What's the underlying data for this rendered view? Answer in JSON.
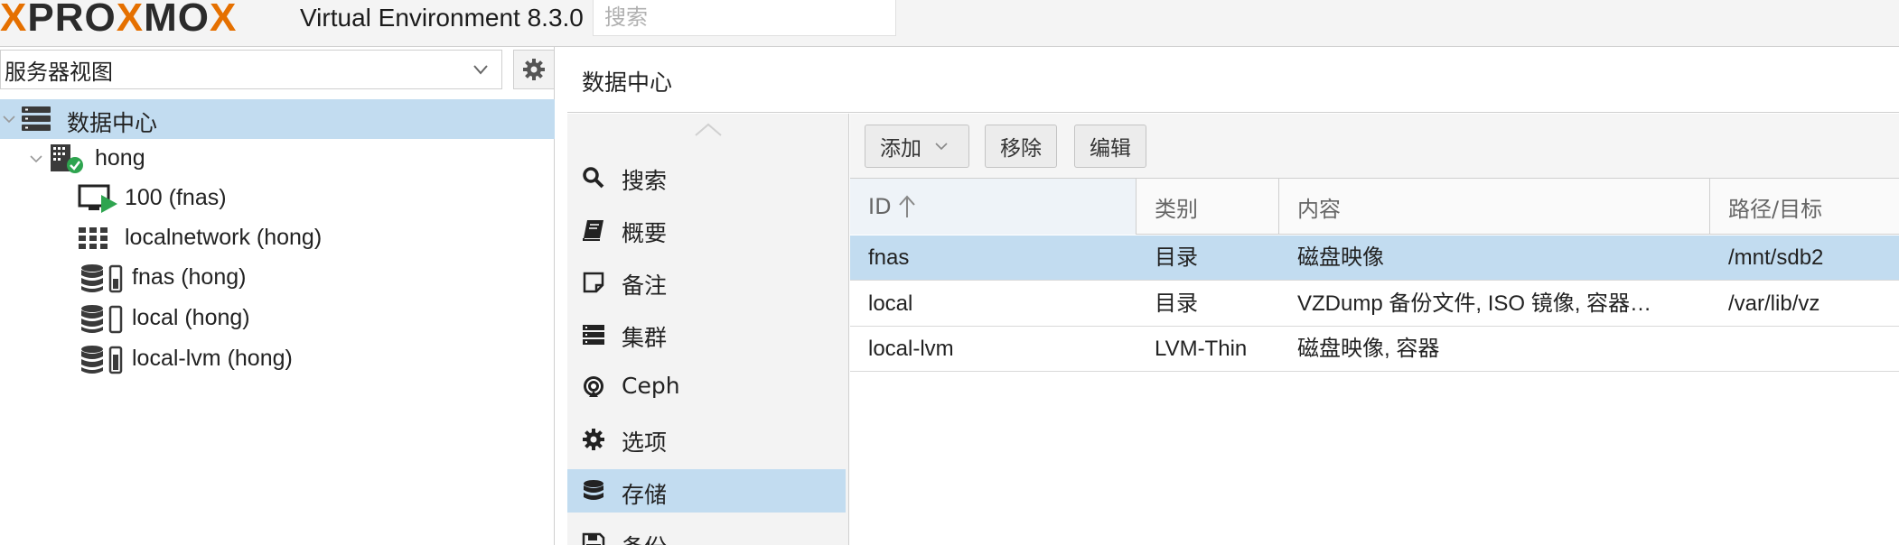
{
  "header": {
    "brand": {
      "part1": "X",
      "part2": "PRO",
      "part3": "X",
      "part4": "MO",
      "part5": "X"
    },
    "version": "Virtual Environment 8.3.0",
    "search_placeholder": "搜索"
  },
  "left": {
    "view_select": "服务器视图",
    "tree": [
      {
        "label": "数据中心",
        "icon": "datacenter-icon",
        "selected": true
      },
      {
        "label": "hong",
        "icon": "node-online-icon"
      },
      {
        "label": "100 (fnas)",
        "icon": "vm-running-icon"
      },
      {
        "label": "localnetwork (hong)",
        "icon": "network-grid-icon"
      },
      {
        "label": "fnas (hong)",
        "icon": "storage-icon"
      },
      {
        "label": "local (hong)",
        "icon": "storage-icon"
      },
      {
        "label": "local-lvm (hong)",
        "icon": "storage-icon"
      }
    ]
  },
  "content": {
    "title": "数据中心",
    "nav": [
      {
        "label": "搜索",
        "icon": "search-icon"
      },
      {
        "label": "概要",
        "icon": "book-icon"
      },
      {
        "label": "备注",
        "icon": "note-icon"
      },
      {
        "label": "集群",
        "icon": "cluster-icon"
      },
      {
        "label": "Ceph",
        "icon": "ceph-icon"
      },
      {
        "label": "选项",
        "icon": "gear-icon"
      },
      {
        "label": "存储",
        "icon": "database-icon",
        "selected": true
      },
      {
        "label": "备份",
        "icon": "floppy-icon"
      }
    ],
    "toolbar": {
      "add": "添加",
      "remove": "移除",
      "edit": "编辑"
    },
    "grid": {
      "columns": {
        "id": "ID",
        "type": "类别",
        "content": "内容",
        "path": "路径/目标"
      },
      "rows": [
        {
          "id": "fnas",
          "type": "目录",
          "content": "磁盘映像",
          "path": "/mnt/sdb2",
          "selected": true
        },
        {
          "id": "local",
          "type": "目录",
          "content": "VZDump 备份文件, ISO 镜像, 容器…",
          "path": "/var/lib/vz"
        },
        {
          "id": "local-lvm",
          "type": "LVM-Thin",
          "content": "磁盘映像, 容器",
          "path": ""
        }
      ]
    }
  },
  "colors": {
    "accent_orange": "#e57000",
    "selection_blue": "#c2dcf0",
    "running_green": "#2ea44f"
  }
}
